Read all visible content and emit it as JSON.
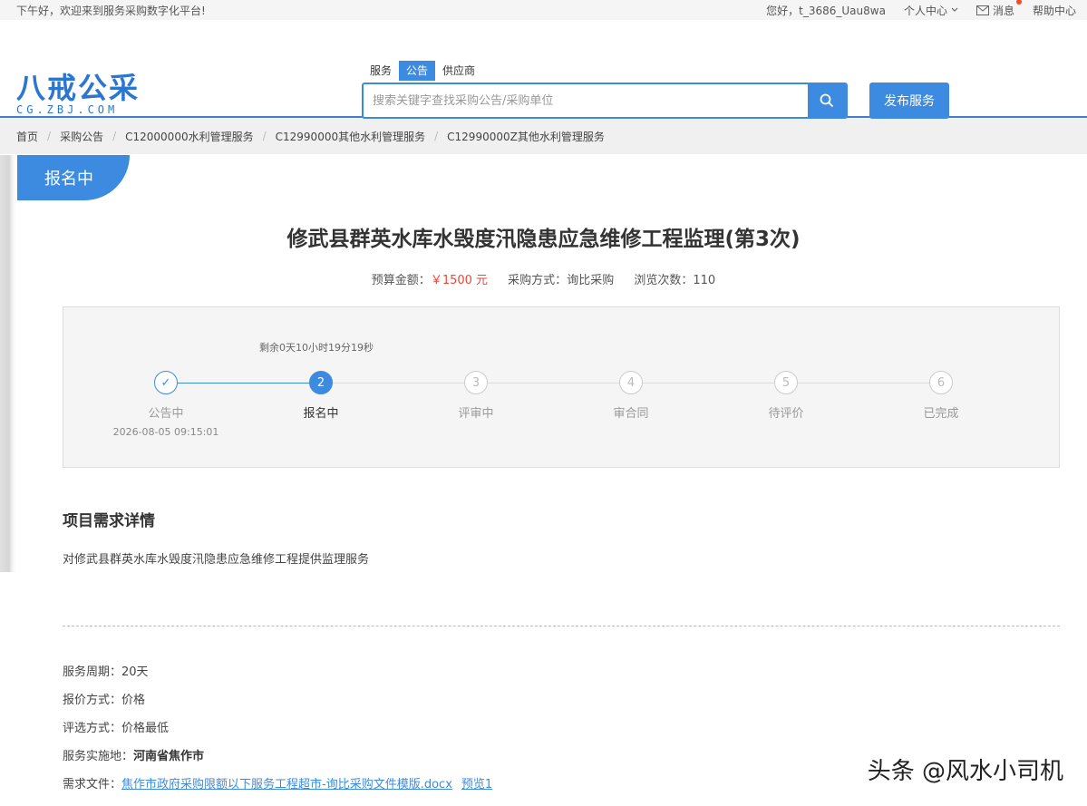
{
  "topbar": {
    "greeting": "下午好，欢迎来到服务采购数字化平台!",
    "user": "您好，t_3686_Uau8wa",
    "personal_center": "个人中心",
    "messages": "消息",
    "help": "帮助中心"
  },
  "logo": {
    "main": "八戒公采",
    "sub": "CG.ZBJ.COM"
  },
  "search": {
    "tabs": [
      "服务",
      "公告",
      "供应商"
    ],
    "active_tab": "公告",
    "placeholder": "搜索关键字查找采购公告/采购单位",
    "value": ""
  },
  "publish_button": "发布服务",
  "breadcrumb": [
    "首页",
    "采购公告",
    "C12000000水利管理服务",
    "C12990000其他水利管理服务",
    "C12990000Z其他水利管理服务"
  ],
  "status_tag": "报名中",
  "title": "修武县群英水库水毁度汛隐患应急维修工程监理(第3次)",
  "meta": {
    "budget_label": "预算金额：",
    "budget_value": "￥1500 元",
    "method_label": "采购方式：",
    "method_value": "询比采购",
    "views_label": "浏览次数：",
    "views_value": "110"
  },
  "progress": {
    "countdown": "剩余0天10小时19分19秒",
    "steps": [
      {
        "num": "✓",
        "label": "公告中",
        "date": "2026-08-05 09:15:01",
        "state": "done"
      },
      {
        "num": "2",
        "label": "报名中",
        "date": "",
        "state": "active"
      },
      {
        "num": "3",
        "label": "评审中",
        "date": "",
        "state": "todo"
      },
      {
        "num": "4",
        "label": "审合同",
        "date": "",
        "state": "todo"
      },
      {
        "num": "5",
        "label": "待评价",
        "date": "",
        "state": "todo"
      },
      {
        "num": "6",
        "label": "已完成",
        "date": "",
        "state": "todo"
      }
    ]
  },
  "details": {
    "heading": "项目需求详情",
    "description": "对修武县群英水库水毁度汛隐患应急维修工程提供监理服务"
  },
  "info": {
    "period_label": "服务周期：",
    "period_value": "20天",
    "quote_label": "报价方式：",
    "quote_value": "价格",
    "select_label": "评选方式：",
    "select_value": "价格最低",
    "location_label": "服务实施地：",
    "location_value": "河南省焦作市",
    "file_label": "需求文件：",
    "file_name": "焦作市政府采购限额以下服务工程超市-询比采购文件模版.docx",
    "preview": "预览1"
  },
  "watermark": "头条 @风水小司机",
  "colors": {
    "accent": "#3d8be0",
    "price": "#e8473a"
  }
}
